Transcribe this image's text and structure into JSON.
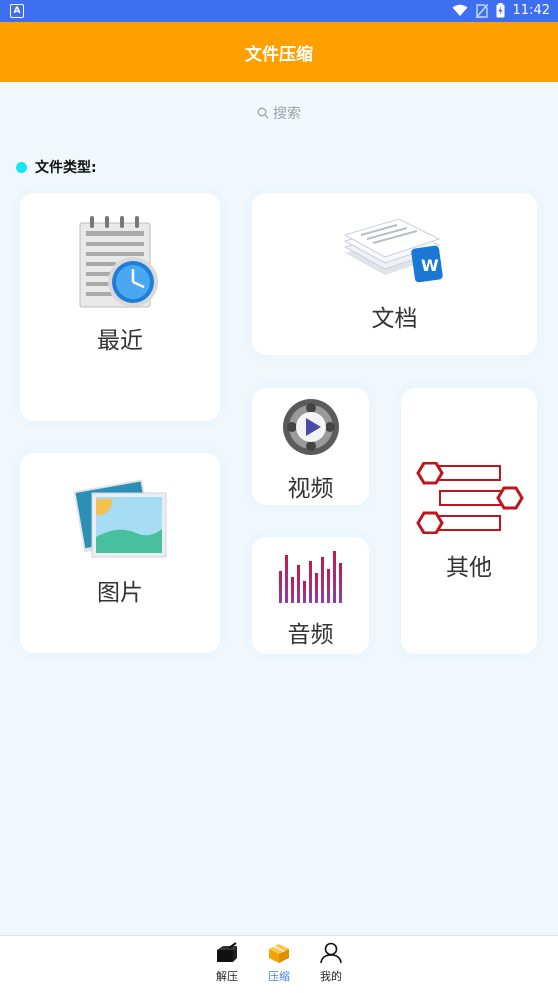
{
  "status_bar": {
    "time": "11:42"
  },
  "app_bar": {
    "title": "文件压缩"
  },
  "search": {
    "placeholder": "搜索"
  },
  "section": {
    "title": "文件类型:"
  },
  "categories": {
    "recent": {
      "label": "最近"
    },
    "docs": {
      "label": "文档"
    },
    "video": {
      "label": "视频"
    },
    "other": {
      "label": "其他"
    },
    "pictures": {
      "label": "图片"
    },
    "audio": {
      "label": "音频"
    }
  },
  "bottom_nav": {
    "items": [
      {
        "label": "解压",
        "icon": "box-unzip-icon",
        "active": false
      },
      {
        "label": "压缩",
        "icon": "box-compress-icon",
        "active": true
      },
      {
        "label": "我的",
        "icon": "person-icon",
        "active": false
      }
    ]
  },
  "colors": {
    "app_bar": "#ff9f00",
    "status_bar": "#3d6ff0",
    "accent": "#3d7fe0",
    "section_dot": "#19e4f2"
  }
}
